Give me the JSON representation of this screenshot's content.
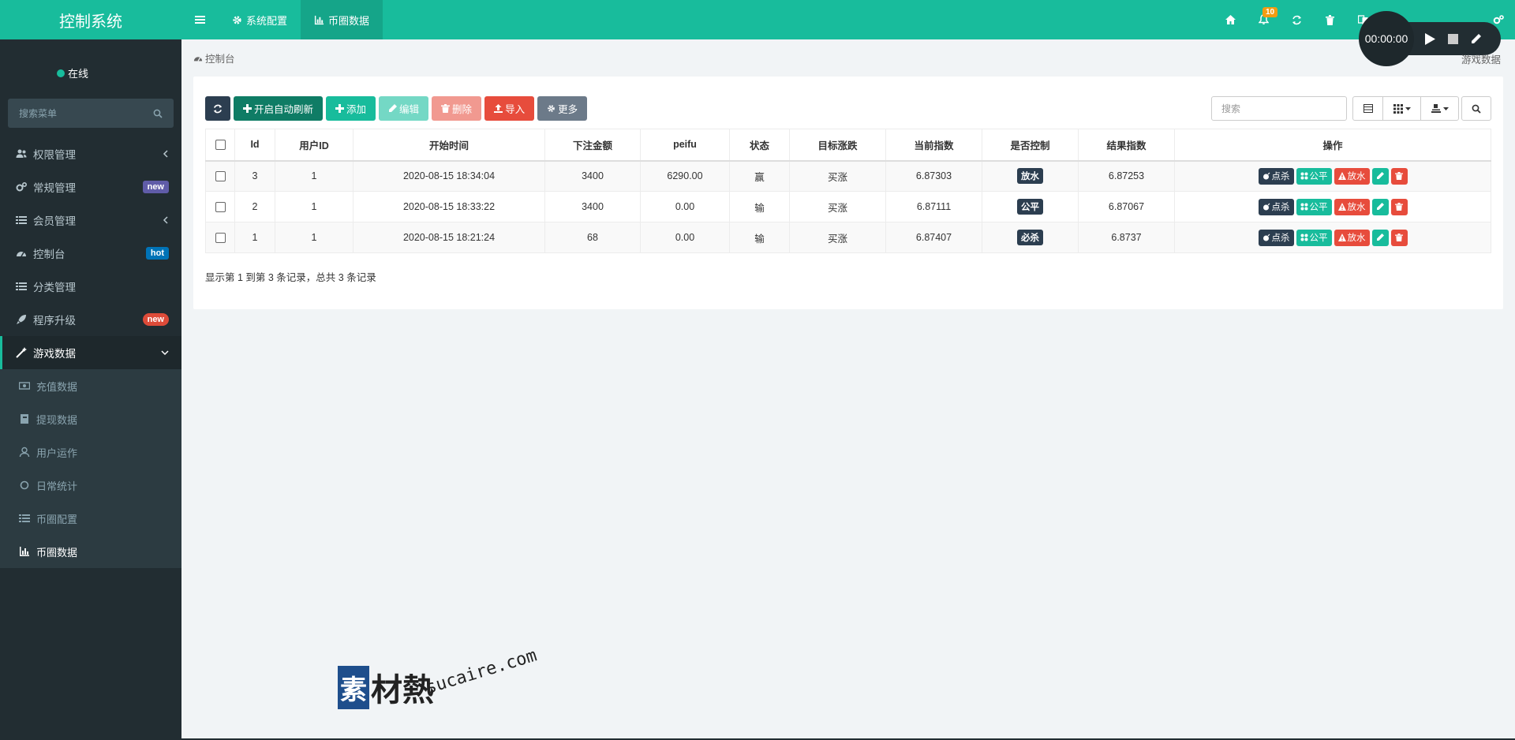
{
  "app": {
    "title": "控制系统",
    "status": "在线"
  },
  "sidebar": {
    "search_placeholder": "搜索菜单",
    "items": [
      {
        "label": "权限管理"
      },
      {
        "label": "常规管理",
        "badge": "new"
      },
      {
        "label": "会员管理"
      },
      {
        "label": "控制台",
        "badge": "hot"
      },
      {
        "label": "分类管理"
      },
      {
        "label": "程序升级",
        "badge": "new"
      },
      {
        "label": "游戏数据"
      }
    ],
    "sub_items": [
      {
        "label": "充值数据"
      },
      {
        "label": "提现数据"
      },
      {
        "label": "用户运作"
      },
      {
        "label": "日常统计"
      },
      {
        "label": "币圈配置"
      },
      {
        "label": "币圈数据"
      }
    ]
  },
  "topbar": {
    "tabs": [
      {
        "label": "系统配置"
      },
      {
        "label": "币圈数据"
      }
    ],
    "notification_count": "10"
  },
  "recorder": {
    "time": "00:00:00"
  },
  "breadcrumb": {
    "label": "控制台",
    "right": "游戏数据"
  },
  "toolbar": {
    "auto_refresh": "开启自动刷新",
    "add": "添加",
    "edit": "编辑",
    "delete": "删除",
    "import": "导入",
    "more": "更多",
    "search_placeholder": "搜索"
  },
  "table": {
    "headers": [
      "Id",
      "用户ID",
      "开始时间",
      "下注金额",
      "peifu",
      "状态",
      "目标涨跌",
      "当前指数",
      "是否控制",
      "结果指数",
      "操作"
    ],
    "rows": [
      {
        "id": "3",
        "uid": "1",
        "time": "2020-08-15 18:34:04",
        "amount": "3400",
        "peifu": "6290.00",
        "status": "赢",
        "target": "买涨",
        "current": "6.87303",
        "control": "放水",
        "result": "6.87253"
      },
      {
        "id": "2",
        "uid": "1",
        "time": "2020-08-15 18:33:22",
        "amount": "3400",
        "peifu": "0.00",
        "status": "输",
        "target": "买涨",
        "current": "6.87111",
        "control": "公平",
        "result": "6.87067"
      },
      {
        "id": "1",
        "uid": "1",
        "time": "2020-08-15 18:21:24",
        "amount": "68",
        "peifu": "0.00",
        "status": "输",
        "target": "买涨",
        "current": "6.87407",
        "control": "必杀",
        "result": "6.8737"
      }
    ],
    "op_labels": {
      "kill": "点杀",
      "fair": "公平",
      "release": "放水"
    }
  },
  "summary": "显示第 1 到第 3 条记录，总共 3 条记录",
  "watermark": {
    "brand": "素材熱",
    "url": "sucaire.com"
  }
}
